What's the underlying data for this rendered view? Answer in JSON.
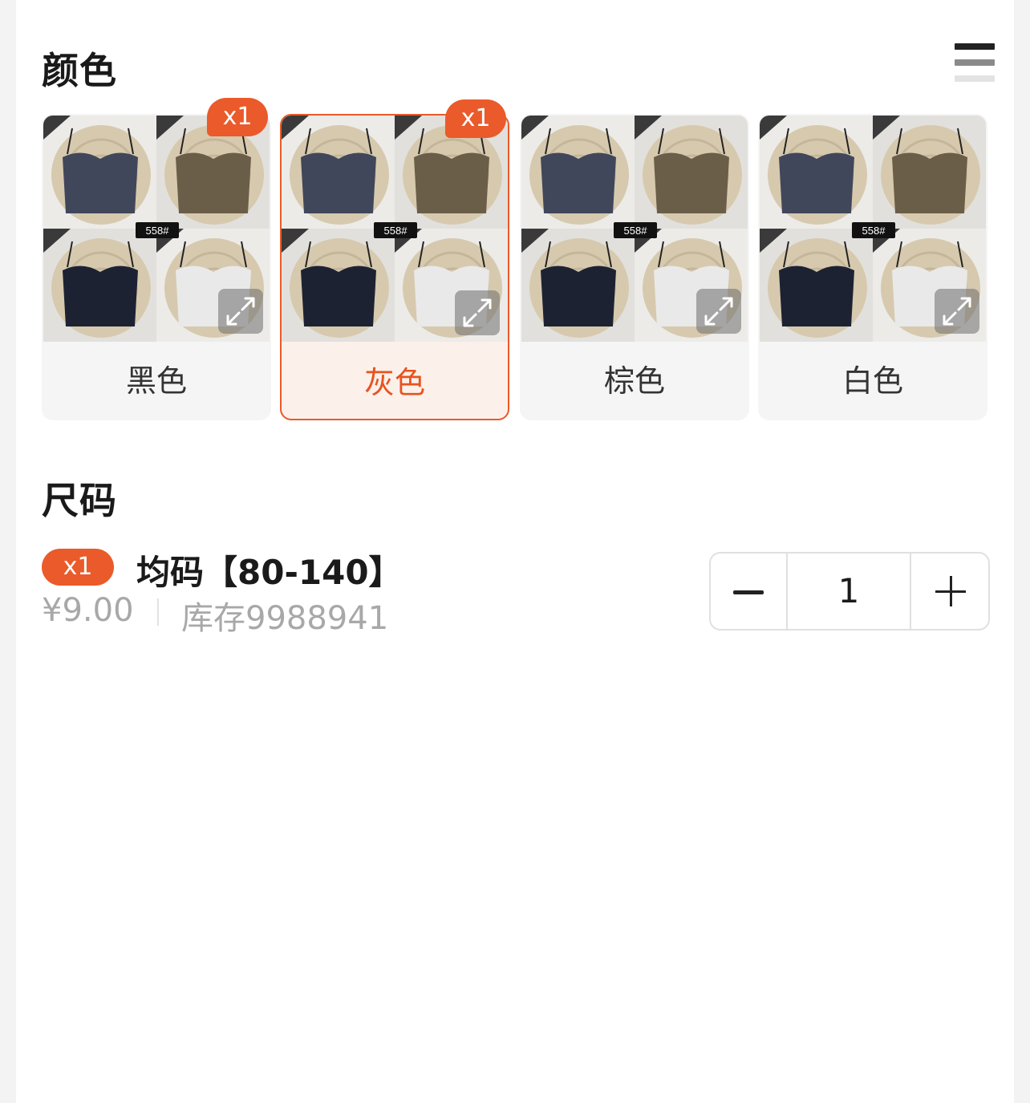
{
  "color_section": {
    "title": "颜色",
    "options": [
      {
        "label": "黑色",
        "badge": "x1",
        "selected": false,
        "image_tag": "558#"
      },
      {
        "label": "灰色",
        "badge": "x1",
        "selected": true,
        "image_tag": "558#"
      },
      {
        "label": "棕色",
        "badge": "",
        "selected": false,
        "image_tag": "558#"
      },
      {
        "label": "白色",
        "badge": "",
        "selected": false,
        "image_tag": "558#"
      }
    ]
  },
  "size_section": {
    "title": "尺码",
    "item": {
      "badge": "x1",
      "name": "均码【80-140】",
      "price": "¥9.00",
      "stock": "库存9988941",
      "quantity": "1"
    }
  },
  "colors": {
    "accent": "#ea5a2a",
    "selected_bg": "#fcf0ea"
  },
  "icons": [
    "list-layout-icon",
    "zoom-expand-icon",
    "minus-icon",
    "plus-icon"
  ]
}
